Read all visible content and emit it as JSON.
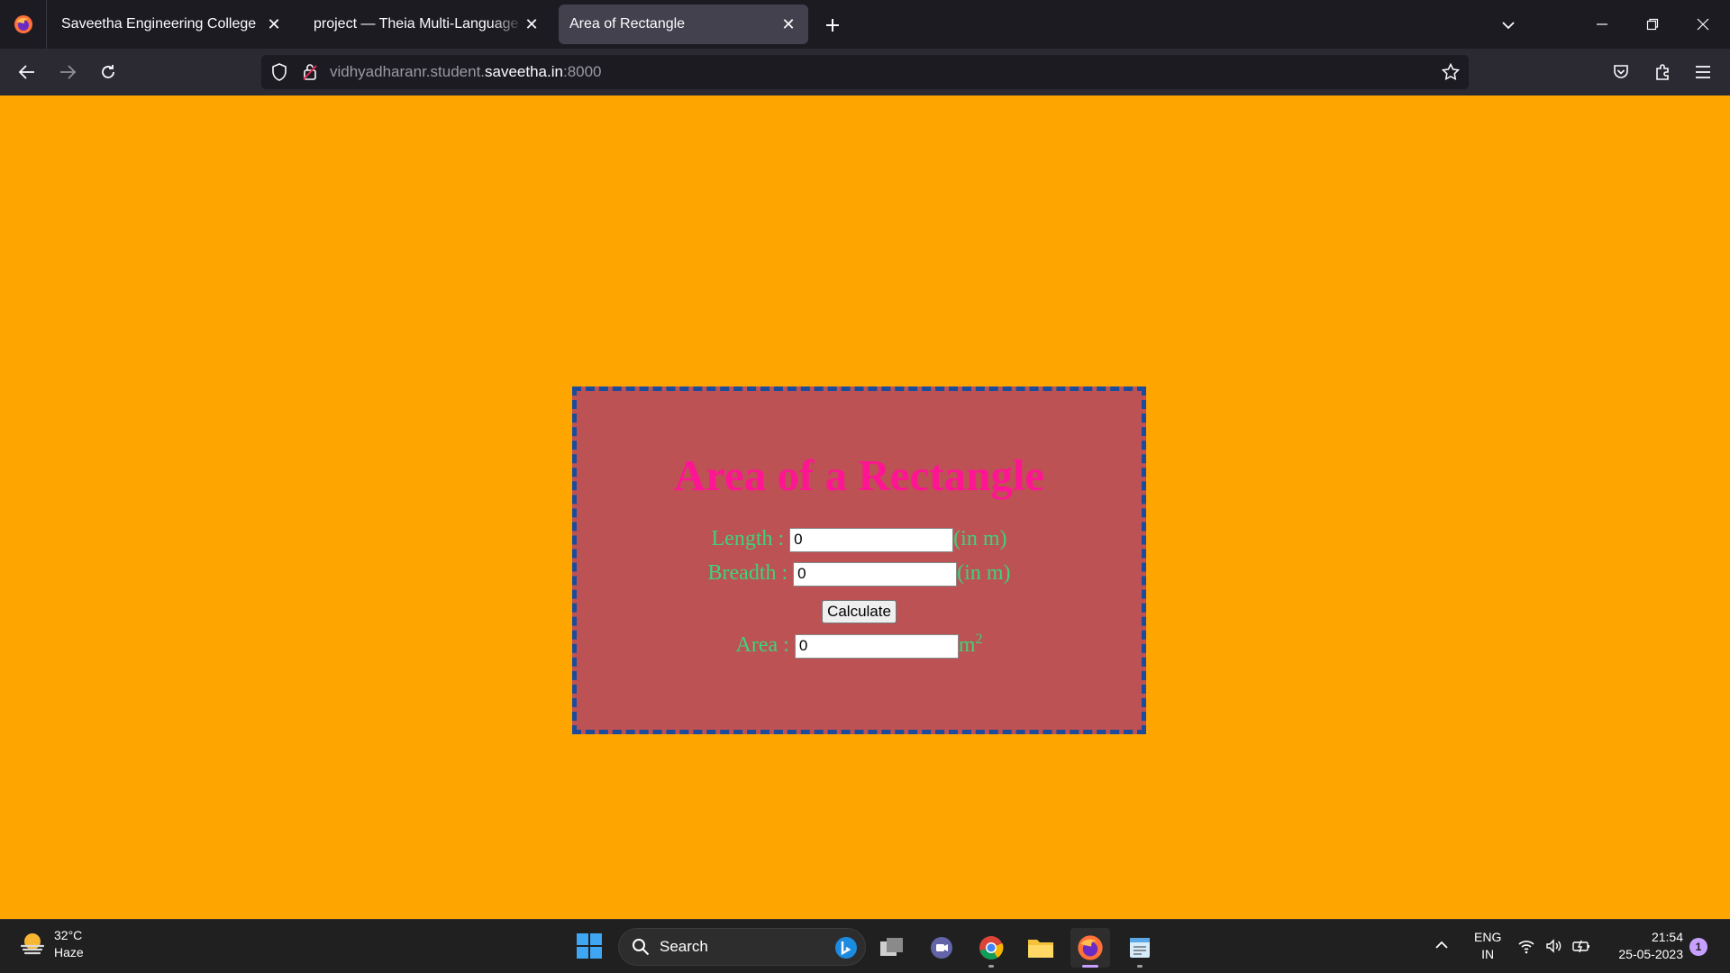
{
  "browser": {
    "tabs": [
      {
        "title": "Saveetha Engineering College"
      },
      {
        "title": "project — Theia Multi-Language Ex"
      },
      {
        "title": "Area of Rectangle"
      }
    ],
    "url": {
      "prefix": "vidhyadharanr.student.",
      "domain": "saveetha.in",
      "suffix": ":8000"
    }
  },
  "page": {
    "title": "Area of a Rectangle",
    "length": {
      "label": "Length : ",
      "value": "0",
      "unit": "(in m)"
    },
    "breadth": {
      "label": "Breadth : ",
      "value": "0",
      "unit": "(in m)"
    },
    "calculate_label": "Calculate",
    "area": {
      "label": "Area : ",
      "value": "0",
      "unit": "m",
      "unit_sup": "2"
    },
    "colors": {
      "background": "#ffa500",
      "box": "#bc5253",
      "border": "#1b4b9c",
      "title": "#ff1493",
      "label": "#3fd37a"
    }
  },
  "taskbar": {
    "weather": {
      "temp": "32°C",
      "desc": "Haze"
    },
    "search_label": "Search",
    "apps": [
      "task-view",
      "teams-chat",
      "chrome",
      "file-explorer",
      "firefox",
      "notepad"
    ],
    "lang": {
      "line1": "ENG",
      "line2": "IN"
    },
    "clock": {
      "time": "21:54",
      "date": "25-05-2023"
    },
    "notifications": "1"
  }
}
